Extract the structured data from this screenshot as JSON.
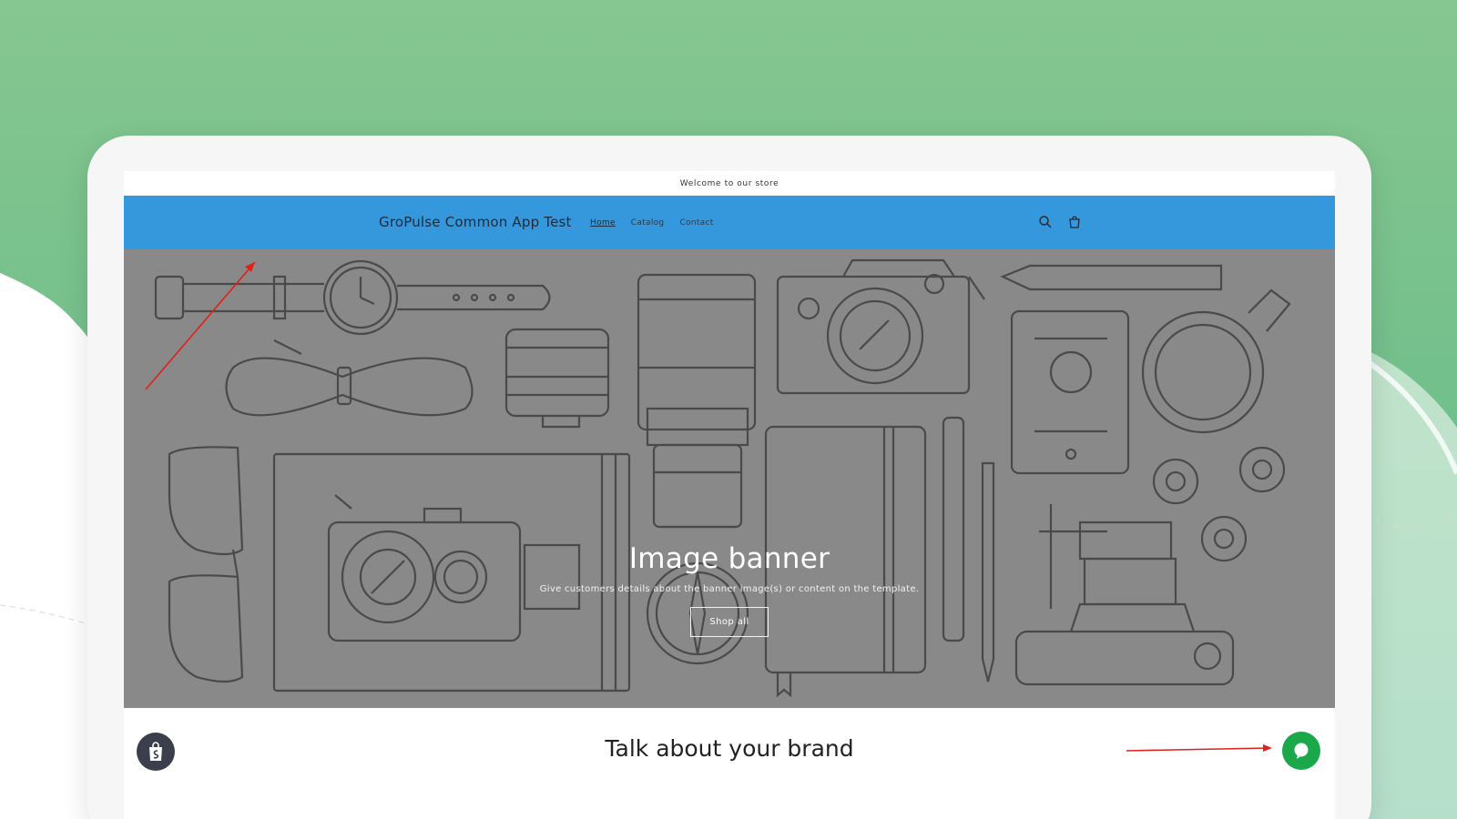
{
  "announcement": {
    "text": "Welcome to our store"
  },
  "header": {
    "store_title": "GroPulse Common App Test",
    "nav": [
      {
        "label": "Home",
        "active": true
      },
      {
        "label": "Catalog",
        "active": false
      },
      {
        "label": "Contact",
        "active": false
      }
    ],
    "icons": [
      "search-icon",
      "cart-icon"
    ]
  },
  "banner": {
    "title": "Image banner",
    "subtitle": "Give customers details about the banner image(s) or content on the template.",
    "button_label": "Shop all"
  },
  "brand": {
    "title": "Talk about your brand"
  },
  "colors": {
    "header_bg": "#3598dc",
    "banner_bg": "#898989",
    "chat_button": "#1aa84b",
    "annotation_arrow": "#e0201b",
    "page_bg": "#7fc48e"
  }
}
